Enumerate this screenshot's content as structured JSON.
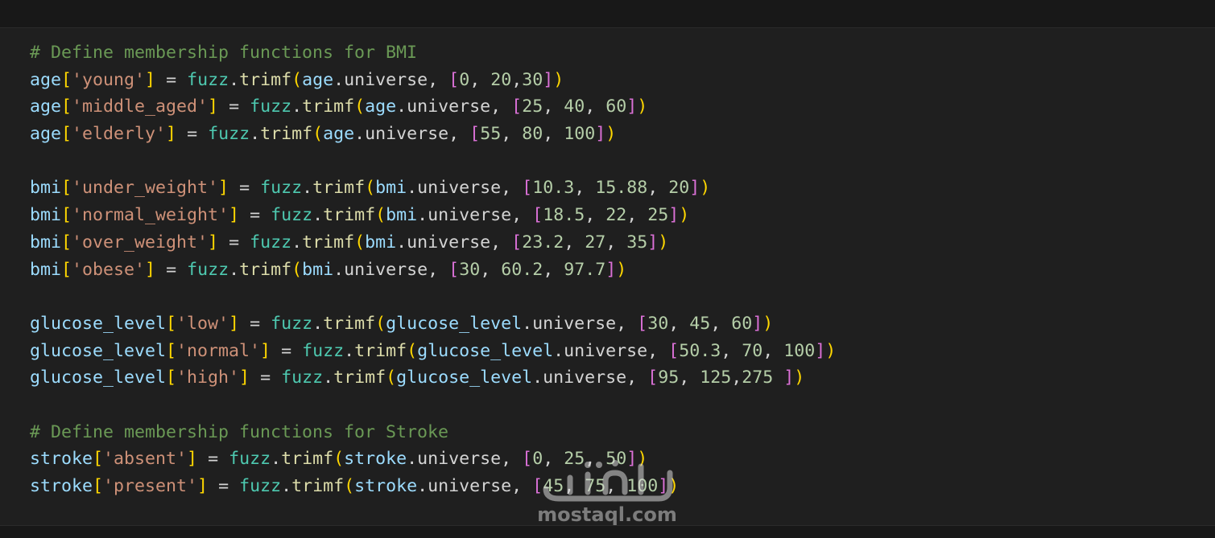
{
  "editor": {
    "lines": [
      [
        [
          "comment",
          "# Define membership functions for BMI"
        ]
      ],
      [
        [
          "var",
          "age"
        ],
        [
          "br1",
          "["
        ],
        [
          "str",
          "'young'"
        ],
        [
          "br1",
          "]"
        ],
        [
          "op",
          " = "
        ],
        [
          "mod",
          "fuzz"
        ],
        [
          "op",
          "."
        ],
        [
          "fn",
          "trimf"
        ],
        [
          "br1",
          "("
        ],
        [
          "var",
          "age"
        ],
        [
          "op",
          ".universe, "
        ],
        [
          "br2",
          "["
        ],
        [
          "num",
          "0"
        ],
        [
          "op",
          ", "
        ],
        [
          "num",
          "20"
        ],
        [
          "op",
          ","
        ],
        [
          "num",
          "30"
        ],
        [
          "br2",
          "]"
        ],
        [
          "br1",
          ")"
        ]
      ],
      [
        [
          "var",
          "age"
        ],
        [
          "br1",
          "["
        ],
        [
          "str",
          "'middle_aged'"
        ],
        [
          "br1",
          "]"
        ],
        [
          "op",
          " = "
        ],
        [
          "mod",
          "fuzz"
        ],
        [
          "op",
          "."
        ],
        [
          "fn",
          "trimf"
        ],
        [
          "br1",
          "("
        ],
        [
          "var",
          "age"
        ],
        [
          "op",
          ".universe, "
        ],
        [
          "br2",
          "["
        ],
        [
          "num",
          "25"
        ],
        [
          "op",
          ", "
        ],
        [
          "num",
          "40"
        ],
        [
          "op",
          ", "
        ],
        [
          "num",
          "60"
        ],
        [
          "br2",
          "]"
        ],
        [
          "br1",
          ")"
        ]
      ],
      [
        [
          "var",
          "age"
        ],
        [
          "br1",
          "["
        ],
        [
          "str",
          "'elderly'"
        ],
        [
          "br1",
          "]"
        ],
        [
          "op",
          " = "
        ],
        [
          "mod",
          "fuzz"
        ],
        [
          "op",
          "."
        ],
        [
          "fn",
          "trimf"
        ],
        [
          "br1",
          "("
        ],
        [
          "var",
          "age"
        ],
        [
          "op",
          ".universe, "
        ],
        [
          "br2",
          "["
        ],
        [
          "num",
          "55"
        ],
        [
          "op",
          ", "
        ],
        [
          "num",
          "80"
        ],
        [
          "op",
          ", "
        ],
        [
          "num",
          "100"
        ],
        [
          "br2",
          "]"
        ],
        [
          "br1",
          ")"
        ]
      ],
      [],
      [
        [
          "var",
          "bmi"
        ],
        [
          "br1",
          "["
        ],
        [
          "str",
          "'under_weight'"
        ],
        [
          "br1",
          "]"
        ],
        [
          "op",
          " = "
        ],
        [
          "mod",
          "fuzz"
        ],
        [
          "op",
          "."
        ],
        [
          "fn",
          "trimf"
        ],
        [
          "br1",
          "("
        ],
        [
          "var",
          "bmi"
        ],
        [
          "op",
          ".universe, "
        ],
        [
          "br2",
          "["
        ],
        [
          "num",
          "10.3"
        ],
        [
          "op",
          ", "
        ],
        [
          "num",
          "15.88"
        ],
        [
          "op",
          ", "
        ],
        [
          "num",
          "20"
        ],
        [
          "br2",
          "]"
        ],
        [
          "br1",
          ")"
        ]
      ],
      [
        [
          "var",
          "bmi"
        ],
        [
          "br1",
          "["
        ],
        [
          "str",
          "'normal_weight'"
        ],
        [
          "br1",
          "]"
        ],
        [
          "op",
          " = "
        ],
        [
          "mod",
          "fuzz"
        ],
        [
          "op",
          "."
        ],
        [
          "fn",
          "trimf"
        ],
        [
          "br1",
          "("
        ],
        [
          "var",
          "bmi"
        ],
        [
          "op",
          ".universe, "
        ],
        [
          "br2",
          "["
        ],
        [
          "num",
          "18.5"
        ],
        [
          "op",
          ", "
        ],
        [
          "num",
          "22"
        ],
        [
          "op",
          ", "
        ],
        [
          "num",
          "25"
        ],
        [
          "br2",
          "]"
        ],
        [
          "br1",
          ")"
        ]
      ],
      [
        [
          "var",
          "bmi"
        ],
        [
          "br1",
          "["
        ],
        [
          "str",
          "'over_weight'"
        ],
        [
          "br1",
          "]"
        ],
        [
          "op",
          " = "
        ],
        [
          "mod",
          "fuzz"
        ],
        [
          "op",
          "."
        ],
        [
          "fn",
          "trimf"
        ],
        [
          "br1",
          "("
        ],
        [
          "var",
          "bmi"
        ],
        [
          "op",
          ".universe, "
        ],
        [
          "br2",
          "["
        ],
        [
          "num",
          "23.2"
        ],
        [
          "op",
          ", "
        ],
        [
          "num",
          "27"
        ],
        [
          "op",
          ", "
        ],
        [
          "num",
          "35"
        ],
        [
          "br2",
          "]"
        ],
        [
          "br1",
          ")"
        ]
      ],
      [
        [
          "var",
          "bmi"
        ],
        [
          "br1",
          "["
        ],
        [
          "str",
          "'obese'"
        ],
        [
          "br1",
          "]"
        ],
        [
          "op",
          " = "
        ],
        [
          "mod",
          "fuzz"
        ],
        [
          "op",
          "."
        ],
        [
          "fn",
          "trimf"
        ],
        [
          "br1",
          "("
        ],
        [
          "var",
          "bmi"
        ],
        [
          "op",
          ".universe, "
        ],
        [
          "br2",
          "["
        ],
        [
          "num",
          "30"
        ],
        [
          "op",
          ", "
        ],
        [
          "num",
          "60.2"
        ],
        [
          "op",
          ", "
        ],
        [
          "num",
          "97.7"
        ],
        [
          "br2",
          "]"
        ],
        [
          "br1",
          ")"
        ]
      ],
      [],
      [
        [
          "var",
          "glucose_level"
        ],
        [
          "br1",
          "["
        ],
        [
          "str",
          "'low'"
        ],
        [
          "br1",
          "]"
        ],
        [
          "op",
          " = "
        ],
        [
          "mod",
          "fuzz"
        ],
        [
          "op",
          "."
        ],
        [
          "fn",
          "trimf"
        ],
        [
          "br1",
          "("
        ],
        [
          "var",
          "glucose_level"
        ],
        [
          "op",
          ".universe, "
        ],
        [
          "br2",
          "["
        ],
        [
          "num",
          "30"
        ],
        [
          "op",
          ", "
        ],
        [
          "num",
          "45"
        ],
        [
          "op",
          ", "
        ],
        [
          "num",
          "60"
        ],
        [
          "br2",
          "]"
        ],
        [
          "br1",
          ")"
        ]
      ],
      [
        [
          "var",
          "glucose_level"
        ],
        [
          "br1",
          "["
        ],
        [
          "str",
          "'normal'"
        ],
        [
          "br1",
          "]"
        ],
        [
          "op",
          " = "
        ],
        [
          "mod",
          "fuzz"
        ],
        [
          "op",
          "."
        ],
        [
          "fn",
          "trimf"
        ],
        [
          "br1",
          "("
        ],
        [
          "var",
          "glucose_level"
        ],
        [
          "op",
          ".universe, "
        ],
        [
          "br2",
          "["
        ],
        [
          "num",
          "50.3"
        ],
        [
          "op",
          ", "
        ],
        [
          "num",
          "70"
        ],
        [
          "op",
          ", "
        ],
        [
          "num",
          "100"
        ],
        [
          "br2",
          "]"
        ],
        [
          "br1",
          ")"
        ]
      ],
      [
        [
          "var",
          "glucose_level"
        ],
        [
          "br1",
          "["
        ],
        [
          "str",
          "'high'"
        ],
        [
          "br1",
          "]"
        ],
        [
          "op",
          " = "
        ],
        [
          "mod",
          "fuzz"
        ],
        [
          "op",
          "."
        ],
        [
          "fn",
          "trimf"
        ],
        [
          "br1",
          "("
        ],
        [
          "var",
          "glucose_level"
        ],
        [
          "op",
          ".universe, "
        ],
        [
          "br2",
          "["
        ],
        [
          "num",
          "95"
        ],
        [
          "op",
          ", "
        ],
        [
          "num",
          "125"
        ],
        [
          "op",
          ","
        ],
        [
          "num",
          "275"
        ],
        [
          "op",
          " "
        ],
        [
          "br2",
          "]"
        ],
        [
          "br1",
          ")"
        ]
      ],
      [],
      [
        [
          "comment",
          "# Define membership functions for Stroke"
        ]
      ],
      [
        [
          "var",
          "stroke"
        ],
        [
          "br1",
          "["
        ],
        [
          "str",
          "'absent'"
        ],
        [
          "br1",
          "]"
        ],
        [
          "op",
          " = "
        ],
        [
          "mod",
          "fuzz"
        ],
        [
          "op",
          "."
        ],
        [
          "fn",
          "trimf"
        ],
        [
          "br1",
          "("
        ],
        [
          "var",
          "stroke"
        ],
        [
          "op",
          ".universe, "
        ],
        [
          "br2",
          "["
        ],
        [
          "num",
          "0"
        ],
        [
          "op",
          ", "
        ],
        [
          "num",
          "25"
        ],
        [
          "op",
          ", "
        ],
        [
          "num",
          "50"
        ],
        [
          "br2",
          "]"
        ],
        [
          "br1",
          ")"
        ]
      ],
      [
        [
          "var",
          "stroke"
        ],
        [
          "br1",
          "["
        ],
        [
          "str",
          "'present'"
        ],
        [
          "br1",
          "]"
        ],
        [
          "op",
          " = "
        ],
        [
          "mod",
          "fuzz"
        ],
        [
          "op",
          "."
        ],
        [
          "fn",
          "trimf"
        ],
        [
          "br1",
          "("
        ],
        [
          "var",
          "stroke"
        ],
        [
          "op",
          ".universe, "
        ],
        [
          "br2",
          "["
        ],
        [
          "num",
          "45"
        ],
        [
          "op",
          ", "
        ],
        [
          "num",
          "75"
        ],
        [
          "op",
          ", "
        ],
        [
          "num",
          "100"
        ],
        [
          "br2",
          "]"
        ],
        [
          "br1",
          ")"
        ]
      ]
    ]
  },
  "watermark": {
    "text": "mostaql.com",
    "logo_icon": "mostaql-logo-icon"
  },
  "colors": {
    "background": "#1f1f1f",
    "comment": "#6a9955",
    "variable": "#9cdcfe",
    "string": "#ce9178",
    "module": "#4ec9b0",
    "function": "#dcdcaa",
    "number": "#b5cea8",
    "bracket_level1": "#ffd700",
    "bracket_level2": "#da70d6"
  }
}
